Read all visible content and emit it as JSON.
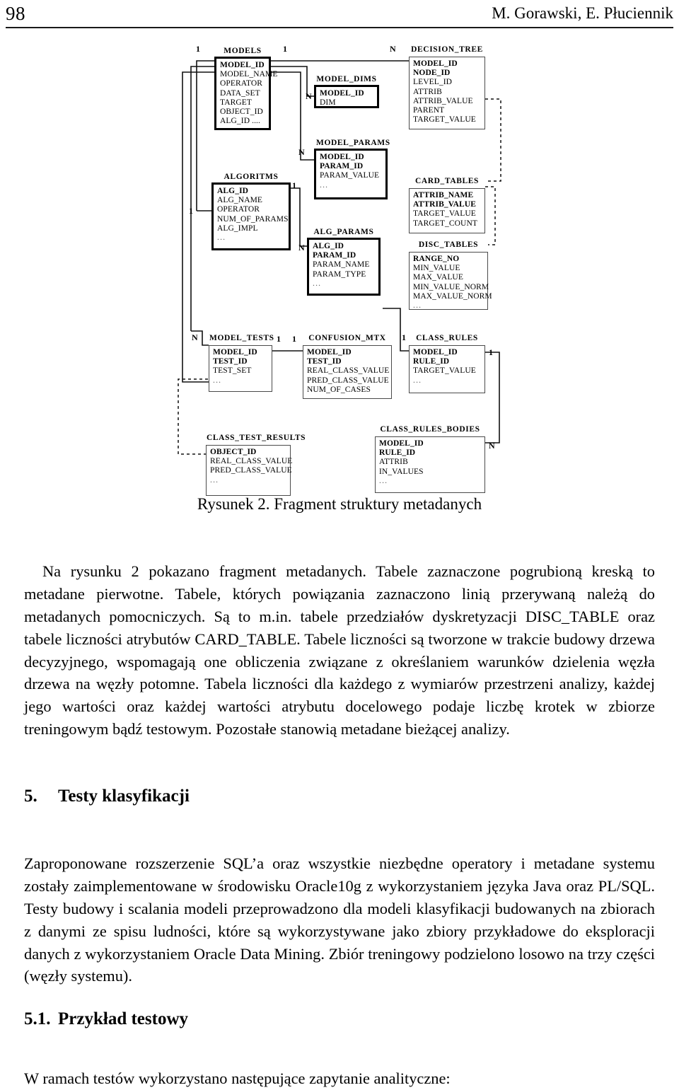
{
  "header": {
    "page_number": "98",
    "authors": "M. Gorawski, E. Płuciennik"
  },
  "figure": {
    "caption": "Rysunek 2. Fragment struktury metadanych",
    "entities": [
      {
        "id": "models",
        "title": "MODELS",
        "primary": true,
        "fields": [
          {
            "name": "MODEL_ID",
            "key": true
          },
          {
            "name": "MODEL_NAME",
            "key": false
          },
          {
            "name": "OPERATOR",
            "key": false
          },
          {
            "name": "DATA_SET",
            "key": false
          },
          {
            "name": "TARGET",
            "key": false
          },
          {
            "name": "OBJECT_ID",
            "key": false
          },
          {
            "name": "ALG_ID ....",
            "key": false
          }
        ]
      },
      {
        "id": "algoritms",
        "title": "ALGORITMS",
        "primary": true,
        "fields": [
          {
            "name": "ALG_ID",
            "key": true
          },
          {
            "name": "ALG_NAME",
            "key": false
          },
          {
            "name": "OPERATOR",
            "key": false
          },
          {
            "name": "NUM_OF_PARAMS",
            "key": false
          },
          {
            "name": "ALG_IMPL",
            "key": false
          },
          {
            "name": "...",
            "key": false
          }
        ]
      },
      {
        "id": "model_dims",
        "title": "MODEL_DIMS",
        "primary": true,
        "fields": [
          {
            "name": "MODEL_ID",
            "key": true
          },
          {
            "name": "DIM",
            "key": false
          }
        ]
      },
      {
        "id": "model_params",
        "title": "MODEL_PARAMS",
        "primary": true,
        "fields": [
          {
            "name": "MODEL_ID",
            "key": true
          },
          {
            "name": "PARAM_ID",
            "key": true
          },
          {
            "name": "PARAM_VALUE",
            "key": false
          },
          {
            "name": "...",
            "key": false
          }
        ]
      },
      {
        "id": "alg_params",
        "title": "ALG_PARAMS",
        "primary": true,
        "fields": [
          {
            "name": "ALG_ID",
            "key": true
          },
          {
            "name": "PARAM_ID",
            "key": true
          },
          {
            "name": "PARAM_NAME",
            "key": false
          },
          {
            "name": "PARAM_TYPE",
            "key": false
          },
          {
            "name": "...",
            "key": false
          }
        ]
      },
      {
        "id": "decision_tree",
        "title": "DECISION_TREE",
        "primary": false,
        "fields": [
          {
            "name": "MODEL_ID",
            "key": true
          },
          {
            "name": "NODE_ID",
            "key": true
          },
          {
            "name": "LEVEL_ID",
            "key": false
          },
          {
            "name": "ATTRIB",
            "key": false
          },
          {
            "name": "ATTRIB_VALUE",
            "key": false
          },
          {
            "name": "PARENT",
            "key": false
          },
          {
            "name": "TARGET_VALUE",
            "key": false
          }
        ]
      },
      {
        "id": "card_tables",
        "title": "CARD_TABLES",
        "primary": false,
        "fields": [
          {
            "name": "ATTRIB_NAME",
            "key": true
          },
          {
            "name": "ATTRIB_VALUE",
            "key": true
          },
          {
            "name": "TARGET_VALUE",
            "key": false
          },
          {
            "name": "TARGET_COUNT",
            "key": false
          }
        ]
      },
      {
        "id": "disc_tables",
        "title": "DISC_TABLES",
        "primary": false,
        "fields": [
          {
            "name": "RANGE_NO",
            "key": true
          },
          {
            "name": "MIN_VALUE",
            "key": false
          },
          {
            "name": "MAX_VALUE",
            "key": false
          },
          {
            "name": "MIN_VALUE_NORM",
            "key": false
          },
          {
            "name": "MAX_VALUE_NORM",
            "key": false
          },
          {
            "name": "...",
            "key": false
          }
        ]
      },
      {
        "id": "model_tests",
        "title": "MODEL_TESTS",
        "primary": false,
        "fields": [
          {
            "name": "MODEL_ID",
            "key": true
          },
          {
            "name": "TEST_ID",
            "key": true
          },
          {
            "name": "TEST_SET",
            "key": false
          },
          {
            "name": "...",
            "key": false
          }
        ]
      },
      {
        "id": "confusion_mtx",
        "title": "CONFUSION_MTX",
        "primary": false,
        "fields": [
          {
            "name": "MODEL_ID",
            "key": true
          },
          {
            "name": "TEST_ID",
            "key": true
          },
          {
            "name": "REAL_CLASS_VALUE",
            "key": false
          },
          {
            "name": "PRED_CLASS_VALUE",
            "key": false
          },
          {
            "name": "NUM_OF_CASES",
            "key": false
          }
        ]
      },
      {
        "id": "class_rules",
        "title": "CLASS_RULES",
        "primary": false,
        "fields": [
          {
            "name": "MODEL_ID",
            "key": true
          },
          {
            "name": "RULE_ID",
            "key": true
          },
          {
            "name": "TARGET_VALUE",
            "key": false
          },
          {
            "name": "...",
            "key": false
          }
        ]
      },
      {
        "id": "class_test_results",
        "title": "CLASS_TEST_RESULTS",
        "primary": false,
        "fields": [
          {
            "name": "OBJECT_ID",
            "key": true
          },
          {
            "name": "REAL_CLASS_VALUE",
            "key": false
          },
          {
            "name": "PRED_CLASS_VALUE",
            "key": false
          },
          {
            "name": "...",
            "key": false
          }
        ]
      },
      {
        "id": "class_rules_bodies",
        "title": "CLASS_RULES_BODIES",
        "primary": false,
        "fields": [
          {
            "name": "MODEL_ID",
            "key": true
          },
          {
            "name": "RULE_ID",
            "key": true
          },
          {
            "name": "ATTRIB",
            "key": false
          },
          {
            "name": "IN_VALUES",
            "key": false
          },
          {
            "name": "...",
            "key": false
          }
        ]
      }
    ],
    "cardinality_labels": [
      {
        "id": "models-left-1",
        "text": "1"
      },
      {
        "id": "models-right-1",
        "text": "1"
      },
      {
        "id": "decision-tree-n",
        "text": "N"
      },
      {
        "id": "model-dims-n",
        "text": "N"
      },
      {
        "id": "model-params-n",
        "text": "N"
      },
      {
        "id": "algoritms-left-1",
        "text": "1"
      },
      {
        "id": "algoritms-right-1",
        "text": "1"
      },
      {
        "id": "alg-params-n",
        "text": "N"
      },
      {
        "id": "model-tests-n",
        "text": "N"
      },
      {
        "id": "model-tests-1",
        "text": "1"
      },
      {
        "id": "confusion-mtx-1",
        "text": "1"
      },
      {
        "id": "class-rules-1-left",
        "text": "1"
      },
      {
        "id": "class-rules-1-right",
        "text": "1"
      },
      {
        "id": "class-rules-bodies-n",
        "text": "N"
      }
    ]
  },
  "body": {
    "paragraph_1": "Na rysunku 2 pokazano fragment metadanych. Tabele zaznaczone pogrubioną kreską to metadane pierwotne. Tabele, których powiązania zaznaczono linią przerywaną należą do metadanych pomocniczych. Są to m.in. tabele przedziałów dyskretyzacji DISC_TABLE oraz tabele liczności atrybutów CARD_TABLE. Tabele liczności są tworzone w trakcie budowy drzewa decyzyjnego, wspomagają one obliczenia związane z określaniem warunków dzielenia węzła drzewa na węzły potomne. Tabela liczności dla każdego z wymiarów przestrzeni analizy, każdej jego wartości oraz każdej wartości atrybutu docelowego podaje liczbę krotek w zbiorze treningowym bądź testowym. Pozostałe stanowią metadane bieżącej analizy.",
    "heading_5_number": "5.",
    "heading_5_title": "Testy klasyfikacji",
    "paragraph_2": "Zaproponowane rozszerzenie SQL’a oraz wszystkie niezbędne operatory i metadane systemu zostały zaimplementowane w środowisku Oracle10g z wykorzystaniem języka Java oraz PL/SQL. Testy budowy i scalania modeli przeprowadzono dla modeli klasyfikacji budowanych na zbiorach z danymi ze spisu ludności, które są wykorzystywane jako zbiory przykładowe do eksploracji danych z wykorzystaniem Oracle Data Mining. Zbiór treningowy podzielono losowo na trzy części (węzły systemu).",
    "heading_51_number": "5.1.",
    "heading_51_title": "Przykład testowy",
    "paragraph_3": "W ramach testów wykorzystano następujące zapytanie analityczne:"
  },
  "colors": {
    "text": "#000000",
    "rule": "#1a1a1a",
    "box_border": "#4a4a4a",
    "primary_border": "#000000"
  }
}
